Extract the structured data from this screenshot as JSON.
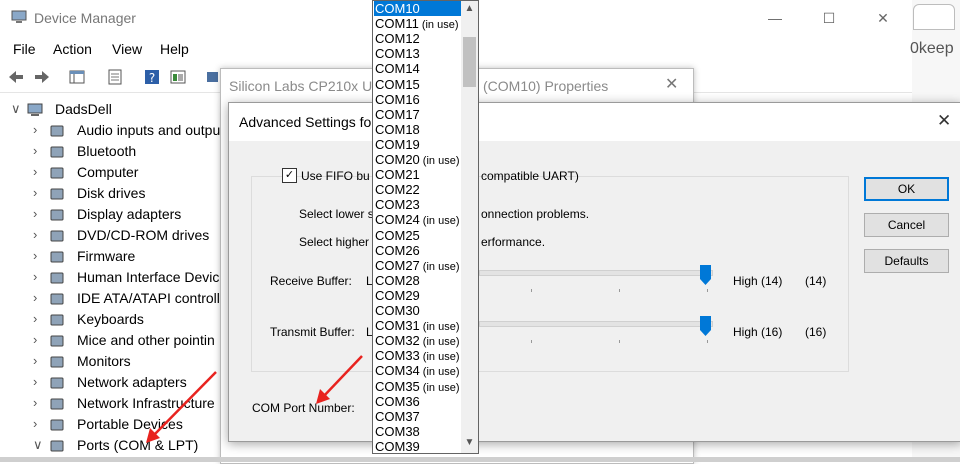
{
  "device_manager": {
    "title": "Device Manager",
    "menu": [
      "File",
      "Action",
      "View",
      "Help"
    ],
    "tree": {
      "root": "DadsDell",
      "items": [
        {
          "label": "Audio inputs and outpu",
          "icon": "speaker-icon"
        },
        {
          "label": "Bluetooth",
          "icon": "bluetooth-icon"
        },
        {
          "label": "Computer",
          "icon": "computer-icon"
        },
        {
          "label": "Disk drives",
          "icon": "disk-drive-icon"
        },
        {
          "label": "Display adapters",
          "icon": "display-adapter-icon"
        },
        {
          "label": "DVD/CD-ROM drives",
          "icon": "dvd-drive-icon"
        },
        {
          "label": "Firmware",
          "icon": "firmware-icon"
        },
        {
          "label": "Human Interface Devic",
          "icon": "hid-icon"
        },
        {
          "label": "IDE ATA/ATAPI controll",
          "icon": "ide-controller-icon"
        },
        {
          "label": "Keyboards",
          "icon": "keyboard-icon"
        },
        {
          "label": "Mice and other pointin",
          "icon": "mouse-icon"
        },
        {
          "label": "Monitors",
          "icon": "monitor-icon"
        },
        {
          "label": "Network adapters",
          "icon": "network-adapter-icon"
        },
        {
          "label": "Network Infrastructure",
          "icon": "network-infrastructure-icon"
        },
        {
          "label": "Portable Devices",
          "icon": "portable-device-icon"
        },
        {
          "label": "Ports (COM & LPT)",
          "icon": "port-icon",
          "expanded": true
        }
      ]
    }
  },
  "browser_fragment": {
    "text": "0keep"
  },
  "properties_dialog": {
    "title": "Silicon Labs CP210x US",
    "title_suffix": "(COM10) Properties"
  },
  "advanced_dialog": {
    "title": "Advanced Settings for",
    "fifo_label": "Use FIFO bu",
    "fifo_label_suffix": "compatible UART)",
    "fifo_checked": true,
    "hint_lower": "Select lower s",
    "hint_lower_suffix": "onnection problems.",
    "hint_higher": "Select higher",
    "hint_higher_suffix": "erformance.",
    "receive": {
      "label": "Receive Buffer:",
      "low_fragment": "L",
      "high_label": "High (14)",
      "value_label": "(14)",
      "level": 1.0
    },
    "transmit": {
      "label": "Transmit Buffer:",
      "low_fragment": "L",
      "high_label": "High (16)",
      "value_label": "(16)",
      "level": 1.0
    },
    "com_port_label": "COM Port Number:",
    "buttons": {
      "ok": "OK",
      "cancel": "Cancel",
      "defaults": "Defaults"
    }
  },
  "com_dropdown": {
    "selected": "COM10",
    "items": [
      {
        "name": "COM10",
        "in_use": ""
      },
      {
        "name": "COM11",
        "in_use": "(in use)"
      },
      {
        "name": "COM12",
        "in_use": ""
      },
      {
        "name": "COM13",
        "in_use": ""
      },
      {
        "name": "COM14",
        "in_use": ""
      },
      {
        "name": "COM15",
        "in_use": ""
      },
      {
        "name": "COM16",
        "in_use": ""
      },
      {
        "name": "COM17",
        "in_use": ""
      },
      {
        "name": "COM18",
        "in_use": ""
      },
      {
        "name": "COM19",
        "in_use": ""
      },
      {
        "name": "COM20",
        "in_use": "(in use)"
      },
      {
        "name": "COM21",
        "in_use": ""
      },
      {
        "name": "COM22",
        "in_use": ""
      },
      {
        "name": "COM23",
        "in_use": ""
      },
      {
        "name": "COM24",
        "in_use": "(in use)"
      },
      {
        "name": "COM25",
        "in_use": ""
      },
      {
        "name": "COM26",
        "in_use": ""
      },
      {
        "name": "COM27",
        "in_use": "(in use)"
      },
      {
        "name": "COM28",
        "in_use": ""
      },
      {
        "name": "COM29",
        "in_use": ""
      },
      {
        "name": "COM30",
        "in_use": ""
      },
      {
        "name": "COM31",
        "in_use": "(in use)"
      },
      {
        "name": "COM32",
        "in_use": "(in use)"
      },
      {
        "name": "COM33",
        "in_use": "(in use)"
      },
      {
        "name": "COM34",
        "in_use": "(in use)"
      },
      {
        "name": "COM35",
        "in_use": "(in use)"
      },
      {
        "name": "COM36",
        "in_use": ""
      },
      {
        "name": "COM37",
        "in_use": ""
      },
      {
        "name": "COM38",
        "in_use": ""
      },
      {
        "name": "COM39",
        "in_use": ""
      }
    ]
  },
  "colors": {
    "selection": "#0078d7",
    "arrow": "#e8231f"
  }
}
